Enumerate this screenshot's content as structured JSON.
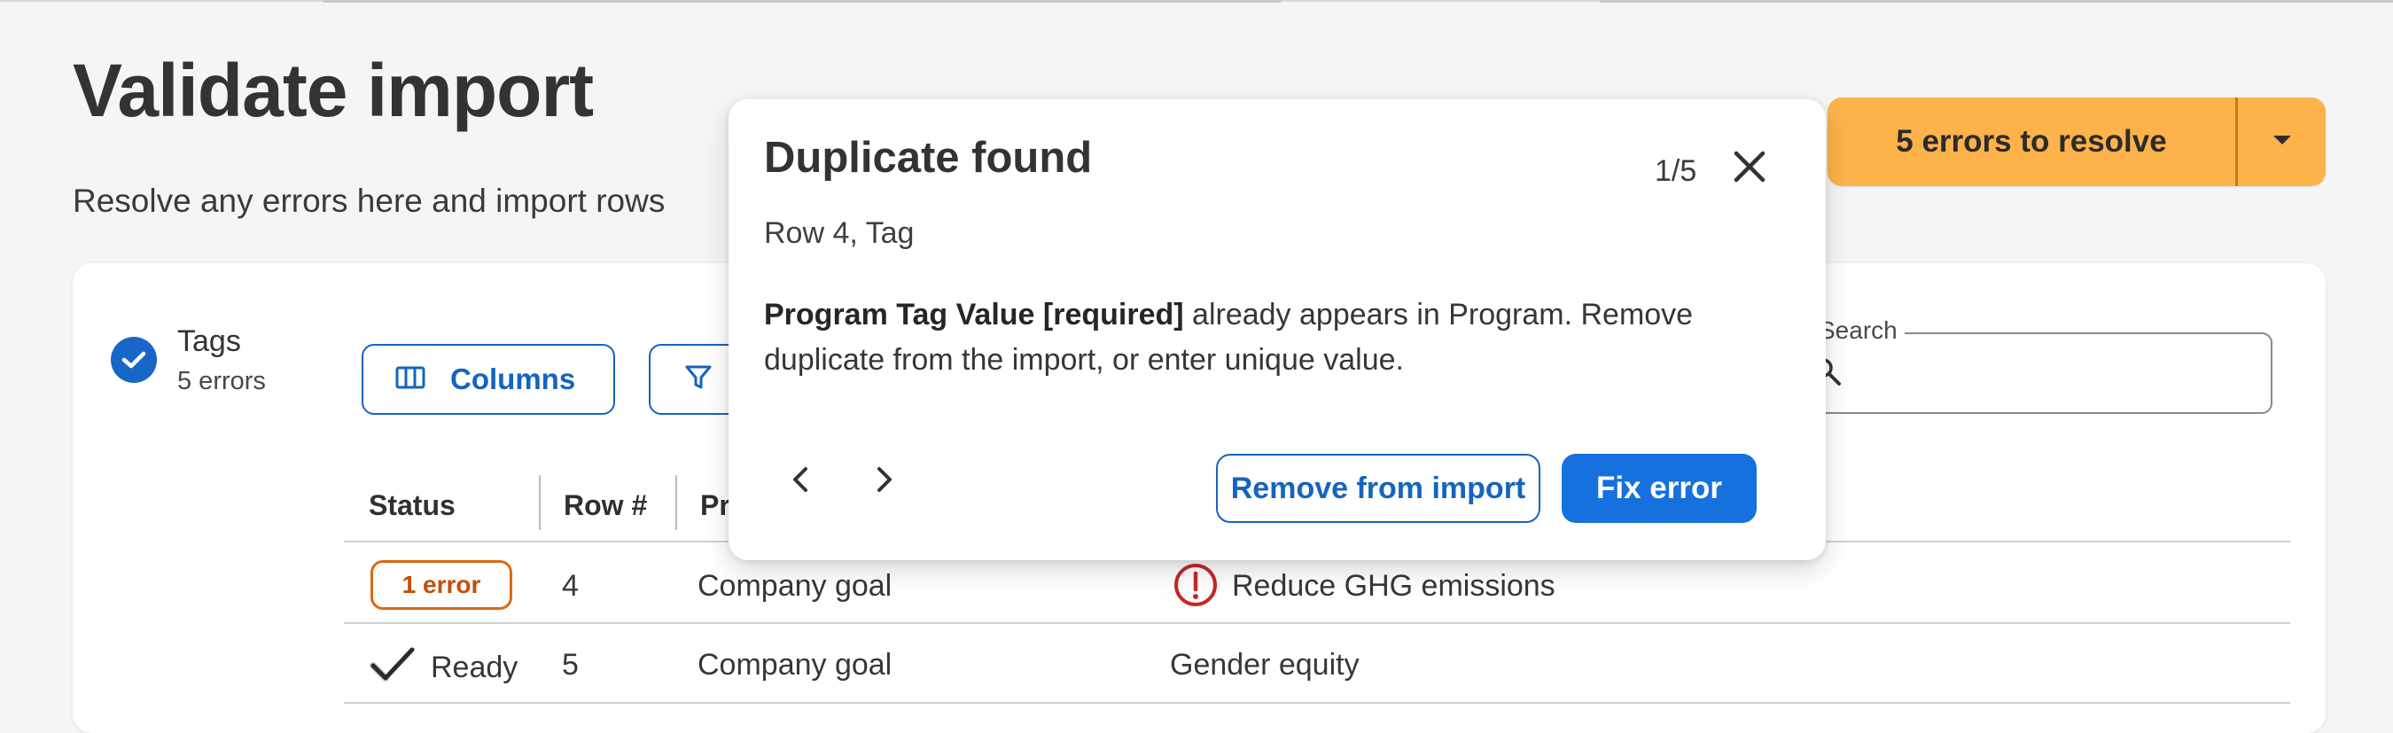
{
  "page": {
    "title": "Validate import",
    "subtitle": "Resolve any errors here and import rows"
  },
  "header": {
    "errors_button_label": "5 errors to resolve"
  },
  "sheet": {
    "name": "Tags",
    "error_count": "5 errors"
  },
  "toolbar": {
    "columns_label": "Columns"
  },
  "search": {
    "label": "Search",
    "value": ""
  },
  "table": {
    "columns": [
      "Status",
      "Row #",
      "Pr"
    ],
    "rows": [
      {
        "status": "1 error",
        "row_number": "4",
        "category": "Company goal",
        "value": "Reduce GHG emissions"
      },
      {
        "status": "Ready",
        "row_number": "5",
        "category": "Company goal",
        "value": "Gender equity"
      }
    ]
  },
  "modal": {
    "title": "Duplicate found",
    "counter": "1/5",
    "location": "Row 4, Tag",
    "message_bold": "Program Tag Value [required]",
    "message_rest": " already appears in Program. Remove duplicate from the import, or enter unique value.",
    "remove_label": "Remove from import",
    "fix_label": "Fix error"
  },
  "colors": {
    "accent": "#1670DE",
    "warning": "#FDB24A",
    "error_badge": "#D96A13",
    "error_icon": "#C62828"
  }
}
